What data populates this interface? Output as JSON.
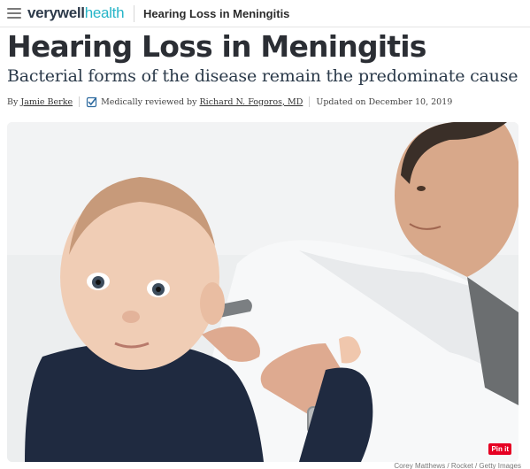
{
  "header": {
    "menu_icon": "hamburger-menu-icon",
    "logo_part1": "verywell",
    "logo_part2": "health",
    "page_title": "Hearing Loss in Meningitis"
  },
  "article": {
    "title": "Hearing Loss in Meningitis",
    "subtitle": "Bacterial forms of the disease remain the predominate cause",
    "byline": {
      "by_prefix": "By",
      "author": "Jamie Berke",
      "reviewed_icon": "verified-check-icon",
      "reviewed_prefix": "Medically reviewed by",
      "reviewer": "Richard N. Fogoros, MD",
      "updated": "Updated on December 10, 2019"
    }
  },
  "image": {
    "pin_label": "Pin it",
    "credit": "Corey Matthews / Rocket / Getty Images"
  },
  "colors": {
    "brand_dark": "#2d3a4a",
    "brand_teal": "#27b5c8",
    "pinterest": "#e60023"
  }
}
